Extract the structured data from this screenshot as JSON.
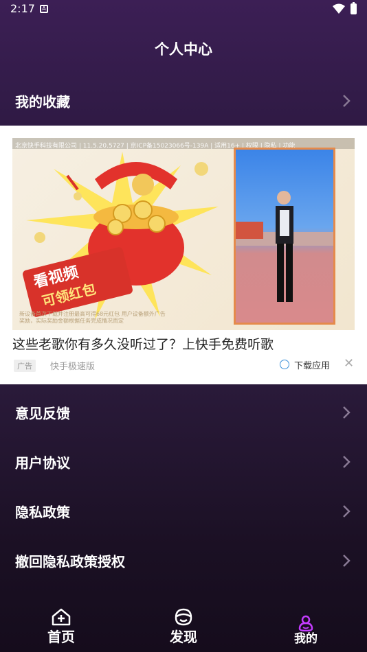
{
  "status_bar": {
    "time": "2:17",
    "notification_icon": "a-box-icon"
  },
  "header": {
    "title": "个人中心"
  },
  "menu_top": {
    "favorites_label": "我的收藏"
  },
  "ad": {
    "top_line": "北京快手科技有限公司 | 11.5.20.5727 | 京ICP备15023066号-139A | 适用16+ | 权限 | 隐私 | 功能",
    "sign_line1": "看视频",
    "sign_line2": "可领红包",
    "bottom_line": "新设备首次下载并注册最高可得68元红包 用户设备额外广告奖励，实际奖励金额根据任务完成情况而定",
    "title": "这些老歌你有多久没听过了？上快手免费听歌",
    "tag": "广告",
    "source": "快手极速版",
    "download_label": "下载应用",
    "close_symbol": "✕"
  },
  "menu": {
    "items": [
      {
        "label": "意见反馈"
      },
      {
        "label": "用户协议"
      },
      {
        "label": "隐私政策"
      },
      {
        "label": "撤回隐私政策授权"
      }
    ]
  },
  "bottom_nav": {
    "items": [
      {
        "label": "首页",
        "icon": "home-icon"
      },
      {
        "label": "发现",
        "icon": "discover-icon"
      },
      {
        "label": "我的",
        "icon": "profile-icon",
        "active": true
      }
    ]
  },
  "colors": {
    "accent": "#c43cff",
    "header_bg": "#3c1f55",
    "body_bg": "#1a1020"
  }
}
